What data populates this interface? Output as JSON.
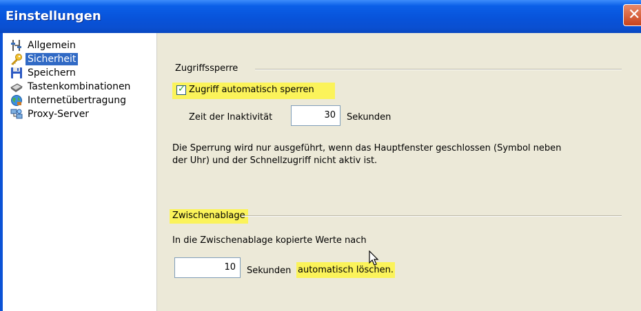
{
  "window": {
    "title": "Einstellungen"
  },
  "sidebar": {
    "items": [
      {
        "label": "Allgemein",
        "icon": "settings-sliders-icon"
      },
      {
        "label": "Sicherheit",
        "icon": "key-icon",
        "selected": true
      },
      {
        "label": "Speichern",
        "icon": "floppy-disk-icon"
      },
      {
        "label": "Tastenkombinationen",
        "icon": "keyboard-icon"
      },
      {
        "label": "Internetübertragung",
        "icon": "globe-icon"
      },
      {
        "label": "Proxy-Server",
        "icon": "network-icon"
      }
    ]
  },
  "lock": {
    "group_title": "Zugriffssperre",
    "checkbox_label": "Zugriff automatisch sperren",
    "checked": true,
    "inactivity_label": "Zeit der Inaktivität",
    "inactivity_value": "30",
    "inactivity_unit": "Sekunden",
    "note_line1": "Die Sperrung wird nur ausgeführt, wenn das Hauptfenster geschlossen (Symbol neben",
    "note_line2": "der Uhr)  und der Schnellzugriff nicht aktiv ist."
  },
  "clipboard": {
    "group_title": "Zwischenablage",
    "description": "In die Zwischenablage kopierte Werte nach",
    "value": "10",
    "unit_prefix": "Sekunden",
    "unit_highlight": "automatisch löschen."
  },
  "colors": {
    "highlight": "#fbf35a",
    "selection": "#316ac5",
    "titlebar": "#0853da"
  }
}
